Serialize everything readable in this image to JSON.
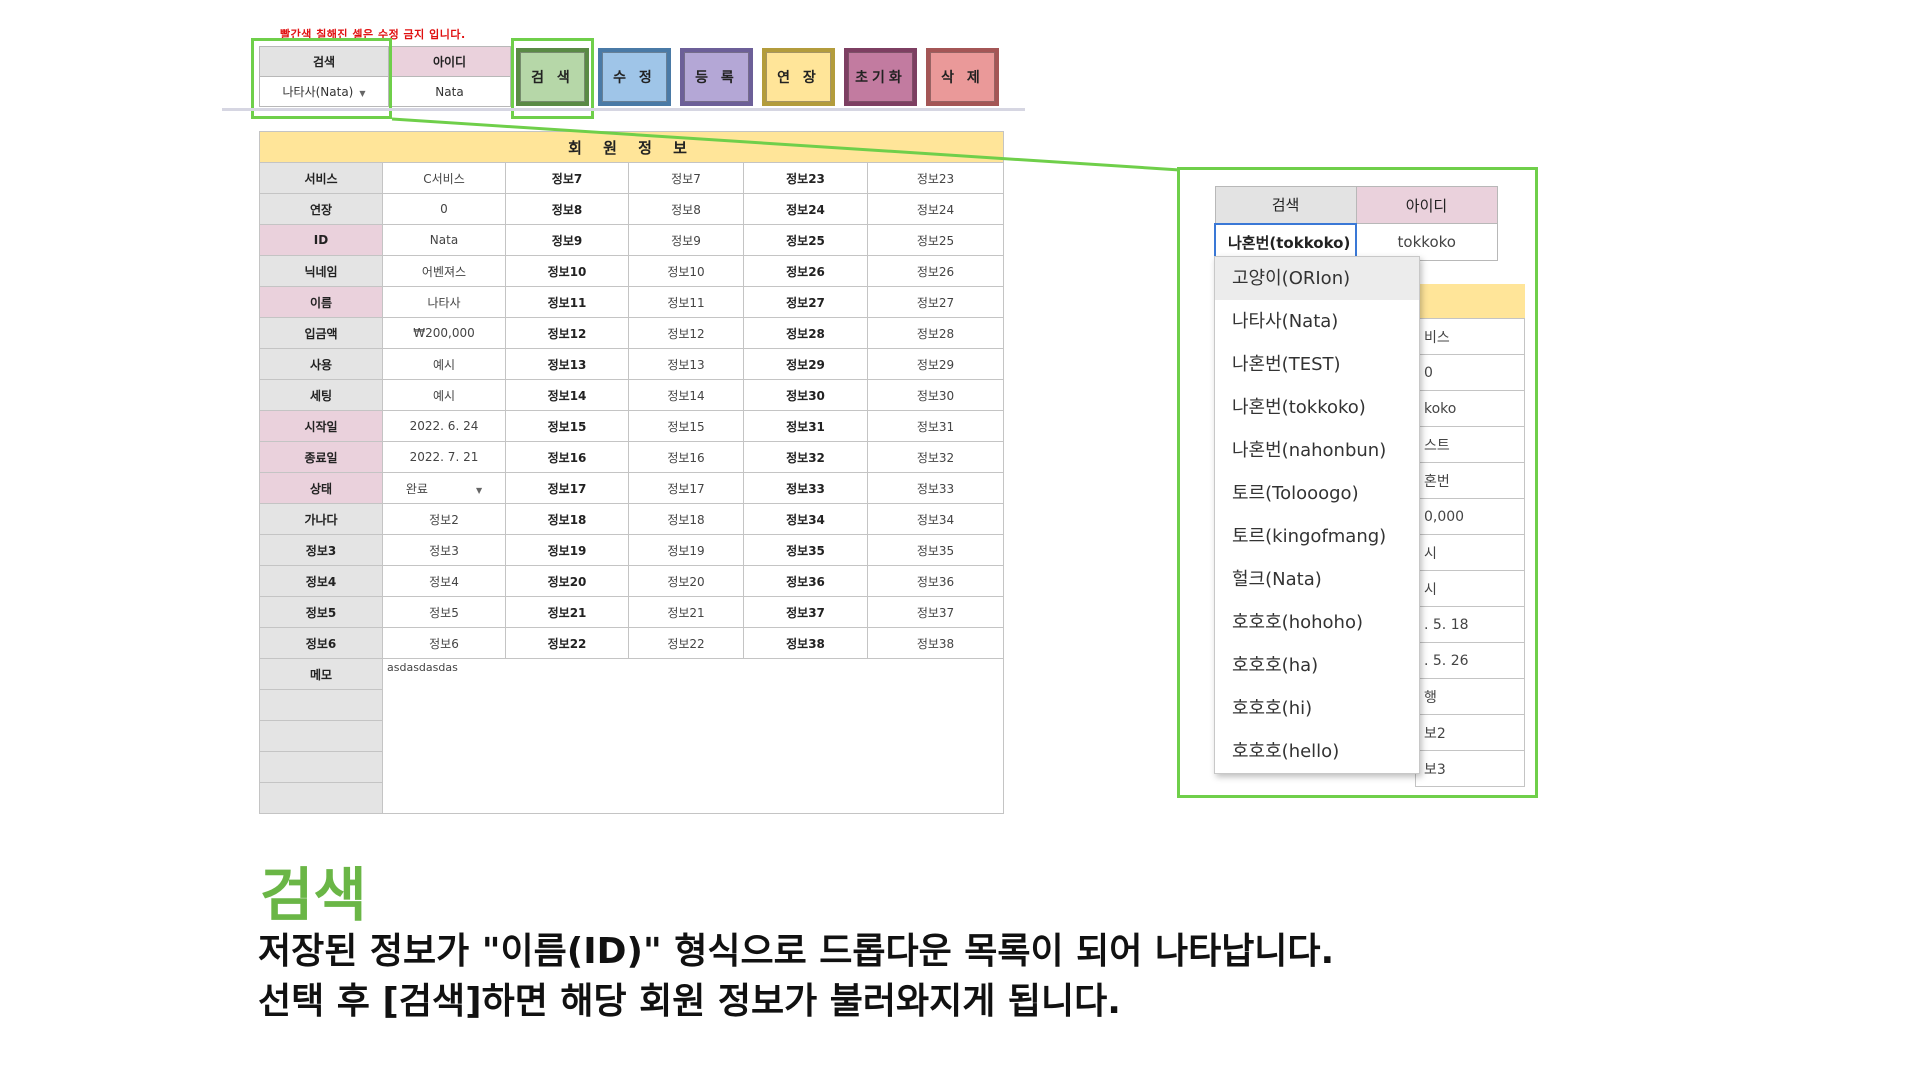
{
  "warning": "빨간색 칠해진 셀은 수정 금지 입니다.",
  "search_table": {
    "search_header": "검색",
    "id_header": "아이디",
    "search_value": "나타사(Nata)",
    "id_value": "Nata"
  },
  "buttons": [
    {
      "label": "검 색",
      "bg": "#b6d7a8",
      "border": "#5a8a45"
    },
    {
      "label": "수 정",
      "bg": "#9fc5e8",
      "border": "#4a7aa6"
    },
    {
      "label": "등 록",
      "bg": "#b4a7d6",
      "border": "#6c5f98"
    },
    {
      "label": "연 장",
      "bg": "#ffe599",
      "border": "#b39c3c"
    },
    {
      "label": "초기화",
      "bg": "#c27ba0",
      "border": "#7d3f62"
    },
    {
      "label": "삭 제",
      "bg": "#ea9999",
      "border": "#a45656"
    }
  ],
  "member_info": {
    "title": "회 원 정 보",
    "rows": [
      [
        "서비스",
        "C서비스",
        "정보7",
        "정보7",
        "정보23",
        "정보23"
      ],
      [
        "연장",
        "0",
        "정보8",
        "정보8",
        "정보24",
        "정보24"
      ],
      [
        "ID",
        "Nata",
        "정보9",
        "정보9",
        "정보25",
        "정보25"
      ],
      [
        "닉네임",
        "어벤져스",
        "정보10",
        "정보10",
        "정보26",
        "정보26"
      ],
      [
        "이름",
        "나타사",
        "정보11",
        "정보11",
        "정보27",
        "정보27"
      ],
      [
        "입금액",
        "₩200,000",
        "정보12",
        "정보12",
        "정보28",
        "정보28"
      ],
      [
        "사용",
        "예시",
        "정보13",
        "정보13",
        "정보29",
        "정보29"
      ],
      [
        "세팅",
        "예시",
        "정보14",
        "정보14",
        "정보30",
        "정보30"
      ],
      [
        "시작일",
        "2022. 6. 24",
        "정보15",
        "정보15",
        "정보31",
        "정보31"
      ],
      [
        "종료일",
        "2022. 7. 21",
        "정보16",
        "정보16",
        "정보32",
        "정보32"
      ],
      [
        "상태",
        "완료",
        "정보17",
        "정보17",
        "정보33",
        "정보33"
      ],
      [
        "가나다",
        "정보2",
        "정보18",
        "정보18",
        "정보34",
        "정보34"
      ],
      [
        "정보3",
        "정보3",
        "정보19",
        "정보19",
        "정보35",
        "정보35"
      ],
      [
        "정보4",
        "정보4",
        "정보20",
        "정보20",
        "정보36",
        "정보36"
      ],
      [
        "정보5",
        "정보5",
        "정보21",
        "정보21",
        "정보37",
        "정보37"
      ],
      [
        "정보6",
        "정보6",
        "정보22",
        "정보22",
        "정보38",
        "정보38"
      ]
    ],
    "pink_labels": [
      "ID",
      "이름",
      "시작일",
      "종료일",
      "상태"
    ],
    "memo_label": "메모",
    "memo_value": "asdasdasdas"
  },
  "zoom": {
    "search_header": "검색",
    "id_header": "아이디",
    "selected": "나혼번(tokkoko)",
    "id_value": "tokkoko",
    "options": [
      "고양이(ORIon)",
      "나타사(Nata)",
      "나혼번(TEST)",
      "나혼번(tokkoko)",
      "나혼번(nahonbun)",
      "토르(Tolooogo)",
      "토르(kingofmang)",
      "헐크(Nata)",
      "호호호(hohoho)",
      "호호호(ha)",
      "호호호(hi)",
      "호호호(hello)"
    ],
    "behind_values": [
      "비스",
      "0",
      "koko",
      "스트",
      "혼번",
      "0,000",
      "시",
      "시",
      ". 5. 18",
      ". 5. 26",
      "행",
      "보2",
      "보3"
    ]
  },
  "caption": {
    "heading": "검색",
    "line1": "저장된 정보가 \"이름(ID)\" 형식으로 드롭다운 목록이 되어 나타납니다.",
    "line2": "선택 후 [검색]하면 해당 회원 정보가 불러와지게 됩니다."
  },
  "colors": {
    "highlight": "#6fcf4a",
    "heading": "#6ab646"
  }
}
